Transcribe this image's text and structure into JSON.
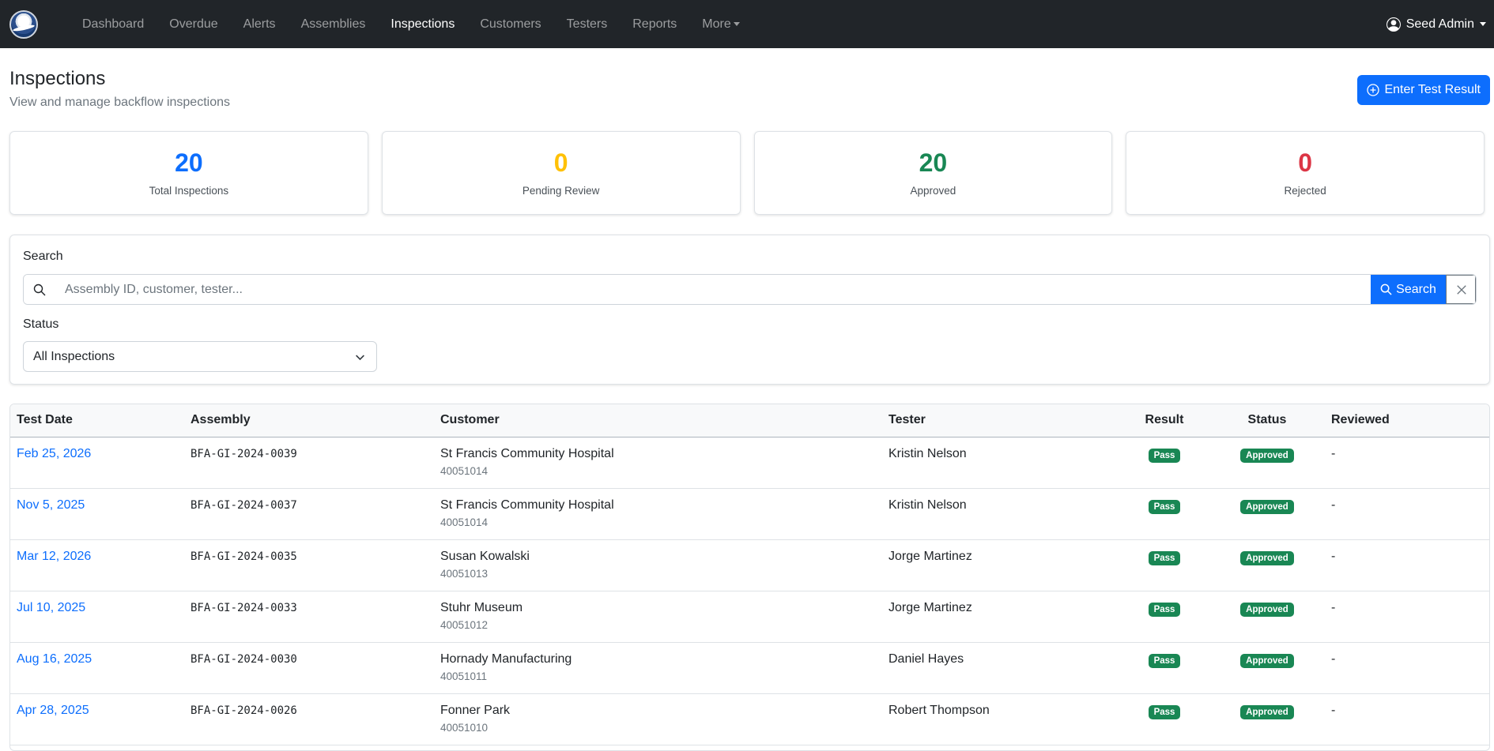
{
  "nav": {
    "items": [
      {
        "label": "Dashboard"
      },
      {
        "label": "Overdue"
      },
      {
        "label": "Alerts"
      },
      {
        "label": "Assemblies"
      },
      {
        "label": "Inspections"
      },
      {
        "label": "Customers"
      },
      {
        "label": "Testers"
      },
      {
        "label": "Reports"
      },
      {
        "label": "More"
      }
    ],
    "active": "Inspections",
    "user": "Seed Admin"
  },
  "header": {
    "title": "Inspections",
    "subtitle": "View and manage backflow inspections",
    "action_label": "Enter Test Result"
  },
  "stats": [
    {
      "value": "20",
      "label": "Total Inspections",
      "color": "#0d6efd"
    },
    {
      "value": "0",
      "label": "Pending Review",
      "color": "#ffc107"
    },
    {
      "value": "20",
      "label": "Approved",
      "color": "#198754"
    },
    {
      "value": "0",
      "label": "Rejected",
      "color": "#dc3545"
    }
  ],
  "filters": {
    "search_label": "Search",
    "search_placeholder": "Assembly ID, customer, tester...",
    "search_button": "Search",
    "status_label": "Status",
    "status_value": "All Inspections"
  },
  "table": {
    "headers": {
      "test_date": "Test Date",
      "assembly": "Assembly",
      "customer": "Customer",
      "tester": "Tester",
      "result": "Result",
      "status": "Status",
      "reviewed": "Reviewed"
    },
    "rows": [
      {
        "date": "Feb 25, 2026",
        "assembly": "BFA-GI-2024-0039",
        "customer": "St Francis Community Hospital",
        "customer_no": "40051014",
        "tester": "Kristin Nelson",
        "result": "Pass",
        "status": "Approved",
        "reviewed": "-"
      },
      {
        "date": "Nov 5, 2025",
        "assembly": "BFA-GI-2024-0037",
        "customer": "St Francis Community Hospital",
        "customer_no": "40051014",
        "tester": "Kristin Nelson",
        "result": "Pass",
        "status": "Approved",
        "reviewed": "-"
      },
      {
        "date": "Mar 12, 2026",
        "assembly": "BFA-GI-2024-0035",
        "customer": "Susan Kowalski",
        "customer_no": "40051013",
        "tester": "Jorge Martinez",
        "result": "Pass",
        "status": "Approved",
        "reviewed": "-"
      },
      {
        "date": "Jul 10, 2025",
        "assembly": "BFA-GI-2024-0033",
        "customer": "Stuhr Museum",
        "customer_no": "40051012",
        "tester": "Jorge Martinez",
        "result": "Pass",
        "status": "Approved",
        "reviewed": "-"
      },
      {
        "date": "Aug 16, 2025",
        "assembly": "BFA-GI-2024-0030",
        "customer": "Hornady Manufacturing",
        "customer_no": "40051011",
        "tester": "Daniel Hayes",
        "result": "Pass",
        "status": "Approved",
        "reviewed": "-"
      },
      {
        "date": "Apr 28, 2025",
        "assembly": "BFA-GI-2024-0026",
        "customer": "Fonner Park",
        "customer_no": "40051010",
        "tester": "Robert Thompson",
        "result": "Pass",
        "status": "Approved",
        "reviewed": "-"
      }
    ]
  }
}
